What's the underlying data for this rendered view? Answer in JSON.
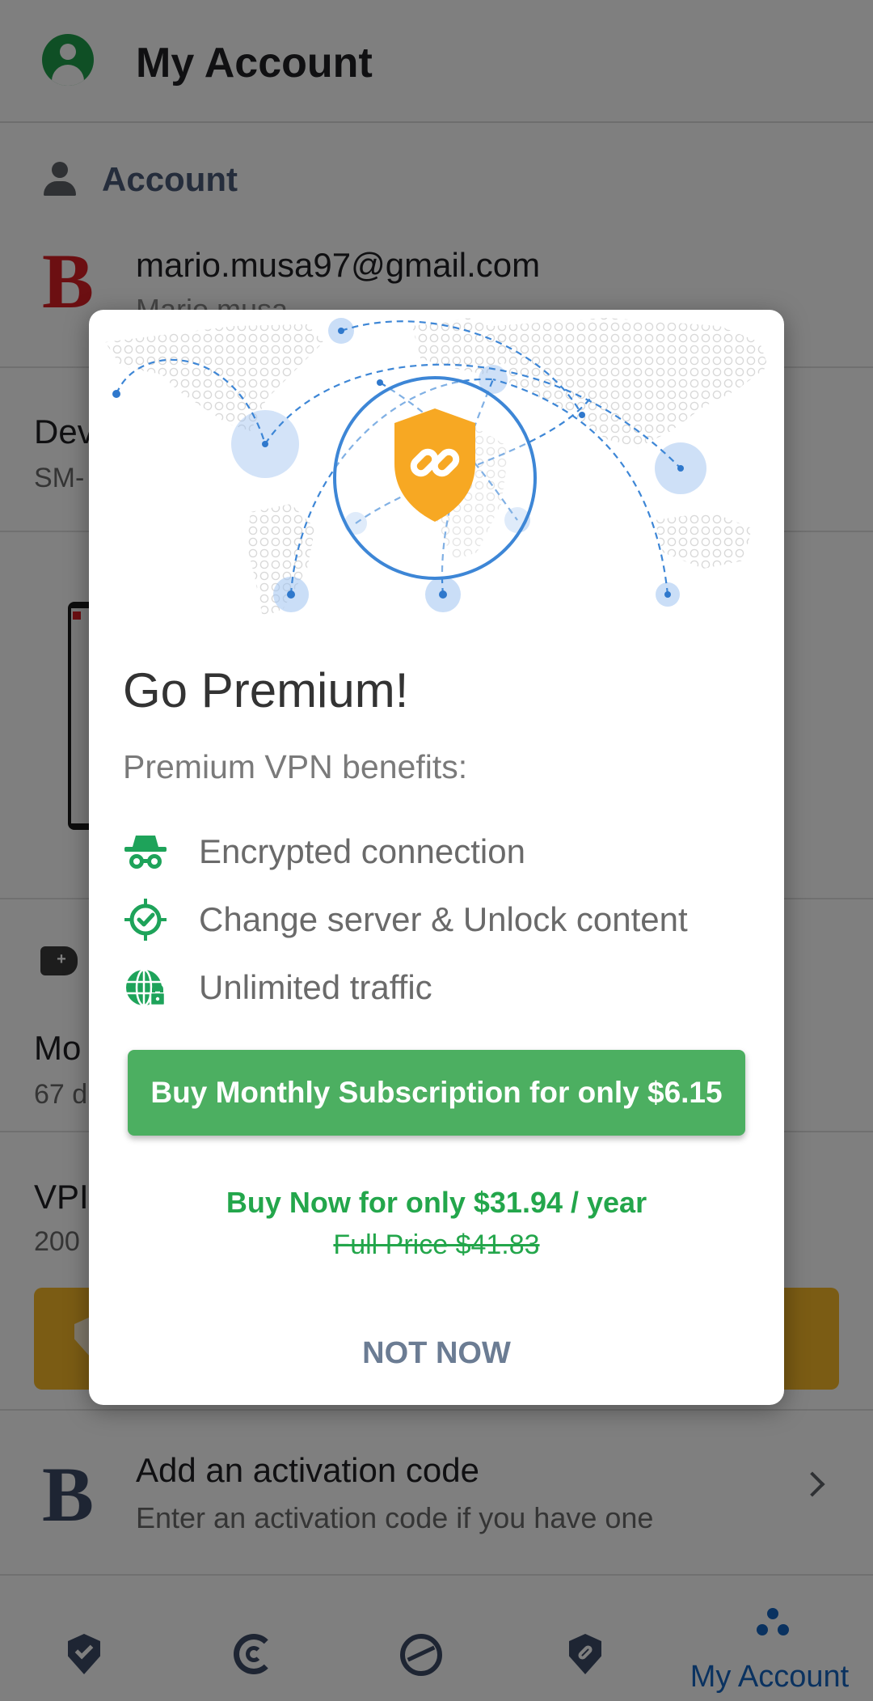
{
  "header": {
    "title": "My Account"
  },
  "account_section": {
    "label": "Account",
    "email": "mario.musa97@gmail.com",
    "name": "Mario.musa"
  },
  "background": {
    "devices_title": "Dev",
    "devices_sub": "SM-",
    "plan_title": "Mo",
    "plan_sub": "67 d",
    "vpn_title": "VPI",
    "vpn_sub": "200"
  },
  "activation": {
    "title": "Add an activation code",
    "subtitle": "Enter an activation code if you have one"
  },
  "bottom_nav": {
    "items": [
      "shield-check-icon",
      "central-icon",
      "web-protection-icon",
      "vpn-shield-icon",
      "account-dots-icon"
    ],
    "active_label": "My Account"
  },
  "dialog": {
    "title": "Go Premium!",
    "subtitle": "Premium VPN benefits:",
    "benefits": [
      {
        "icon": "incognito-icon",
        "label": "Encrypted connection"
      },
      {
        "icon": "target-check-icon",
        "label": "Change server & Unlock content"
      },
      {
        "icon": "globe-lock-icon",
        "label": "Unlimited traffic"
      }
    ],
    "monthly_button": "Buy Monthly Subscription for only $6.15",
    "yearly_offer": "Buy Now for only $31.94 / year",
    "full_price": "Full Price $41.83",
    "dismiss_button": "NOT NOW"
  },
  "colors": {
    "accent_green": "#4caf61",
    "offer_green": "#23a64b",
    "brand_red": "#d91e24",
    "nav_active_blue": "#1565c0",
    "shield_orange": "#f7a823"
  }
}
